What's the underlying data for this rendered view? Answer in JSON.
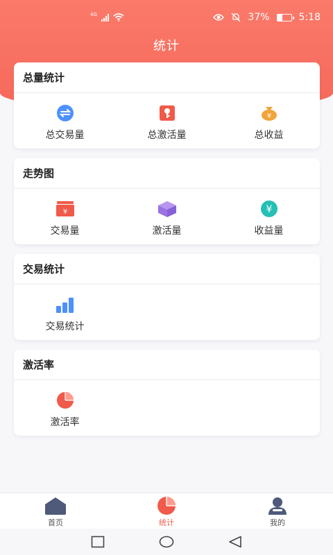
{
  "status_bar": {
    "network_type": "4G",
    "battery": "37%",
    "battery_level": 0.37,
    "time": "5:18"
  },
  "header": {
    "title": "统计"
  },
  "sections": [
    {
      "title": "总量统计",
      "items": [
        {
          "label": "总交易量",
          "icon": "exchange-icon"
        },
        {
          "label": "总激活量",
          "icon": "key-icon"
        },
        {
          "label": "总收益",
          "icon": "money-bag-icon"
        }
      ]
    },
    {
      "title": "走势图",
      "items": [
        {
          "label": "交易量",
          "icon": "wallet-icon"
        },
        {
          "label": "激活量",
          "icon": "box-icon"
        },
        {
          "label": "收益量",
          "icon": "yen-coin-icon"
        }
      ]
    },
    {
      "title": "交易统计",
      "items": [
        {
          "label": "交易统计",
          "icon": "bar-chart-icon"
        }
      ]
    },
    {
      "title": "激活率",
      "items": [
        {
          "label": "激活率",
          "icon": "pie-chart-icon"
        }
      ]
    }
  ],
  "tabbar": {
    "items": [
      {
        "label": "首页",
        "icon": "home-icon"
      },
      {
        "label": "统计",
        "icon": "pie-chart-icon",
        "active": true
      },
      {
        "label": "我的",
        "icon": "user-icon"
      }
    ]
  },
  "colors": {
    "accent": "#f05a4a",
    "header_gradient_top": "#fb7a6a",
    "blue": "#4d90fe",
    "purple": "#a07de8",
    "teal": "#25bfb5",
    "orange": "#f0a43a"
  }
}
